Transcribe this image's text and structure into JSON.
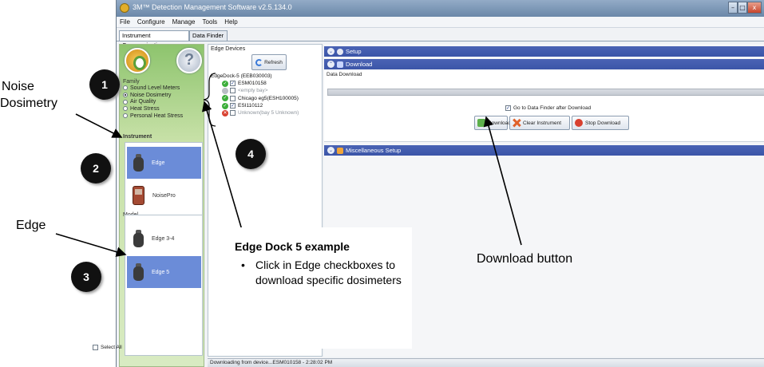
{
  "window": {
    "title": "3M™ Detection Management Software v2.5.134.0",
    "controls": [
      "–",
      "□",
      "x"
    ]
  },
  "menu": [
    "File",
    "Configure",
    "Manage",
    "Tools",
    "Help"
  ],
  "tabs": [
    "Instrument Communications",
    "Data Finder"
  ],
  "family": {
    "label": "Family",
    "options": [
      "Sound Level Meters",
      "Noise Dosimetry",
      "Air Quality",
      "Heat Stress",
      "Personal Heat Stress"
    ],
    "selected": "Noise Dosimetry"
  },
  "instrument": {
    "label": "Instrument",
    "items": [
      "Edge",
      "NoisePro"
    ],
    "selected": "Edge"
  },
  "model": {
    "label": "Model",
    "items": [
      "Edge 3-4",
      "Edge 5"
    ],
    "selected": "Edge 5"
  },
  "edge_devices": {
    "label": "Edge Devices",
    "refresh_label": "Refresh",
    "dock_label": "EdgeDock-5 (EEB030003)",
    "devices": [
      {
        "name": "ESM010158",
        "status": "ok",
        "checked": true
      },
      {
        "name": "<empty bay>",
        "status": "empty",
        "checked": false
      },
      {
        "name": "Chicago eg5(ESH100005)",
        "status": "ok",
        "checked": false
      },
      {
        "name": "ESI110112",
        "status": "ok",
        "checked": true
      },
      {
        "name": "Unknown(bay 5 Unknown)",
        "status": "error",
        "checked": false
      }
    ],
    "select_all_label": "Select All"
  },
  "content": {
    "setup_label": "Setup",
    "download_label": "Download",
    "data_download_label": "Data Download",
    "goto_label": "Go to Data Finder after Download",
    "buttons": {
      "download": "Download",
      "clear": "Clear Instrument",
      "stop": "Stop Download"
    },
    "misc_label": "Miscellaneous Setup"
  },
  "status": "Downloading from device...ESM010158 - 2:28:02 PM",
  "annotations": {
    "badges": [
      "1",
      "2",
      "3",
      "4"
    ],
    "noise_callout_line1": "Noise",
    "noise_callout_line2": "Dosimetry",
    "edge_callout": "Edge",
    "download_callout": "Download button",
    "edge_box_title": "Edge Dock 5 example",
    "edge_box_bullet": "Click in Edge checkboxes to download specific dosimeters"
  },
  "icons": {
    "home": "home-icon",
    "help": "help-icon",
    "refresh": "refresh-icon",
    "ok": "green-check-icon",
    "error": "red-x-icon"
  },
  "colors": {
    "accent_bar": "#3b55a8",
    "selected_tile": "#6b8cd8",
    "panel_green": "#8dc46d"
  }
}
